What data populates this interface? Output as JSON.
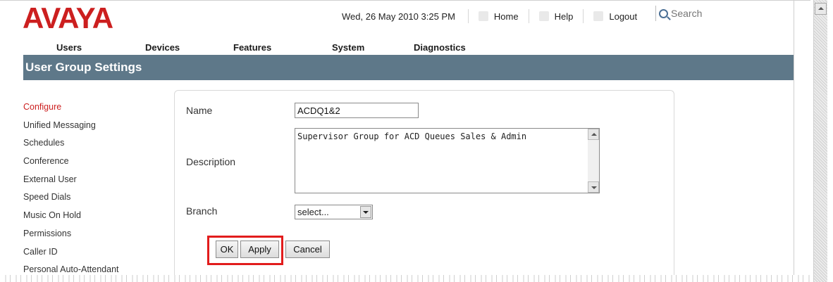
{
  "brand": {
    "logo_text": "AVAYA"
  },
  "topbar": {
    "datetime": "Wed, 26 May 2010 3:25 PM",
    "home_label": "Home",
    "help_label": "Help",
    "logout_label": "Logout",
    "search_placeholder": "Search"
  },
  "nav": {
    "items": [
      {
        "label": "Users"
      },
      {
        "label": "Devices"
      },
      {
        "label": "Features"
      },
      {
        "label": "System"
      },
      {
        "label": "Diagnostics"
      }
    ]
  },
  "page_title": "User Group Settings",
  "sidebar": {
    "items": [
      {
        "label": "Configure"
      },
      {
        "label": "Unified Messaging"
      },
      {
        "label": "Schedules"
      },
      {
        "label": "Conference"
      },
      {
        "label": "External User"
      },
      {
        "label": "Speed Dials"
      },
      {
        "label": "Music On Hold"
      },
      {
        "label": "Permissions"
      },
      {
        "label": "Caller ID"
      },
      {
        "label": "Personal Auto-Attendant"
      }
    ]
  },
  "form": {
    "name_label": "Name",
    "name_value": "ACDQ1&2",
    "description_label": "Description",
    "description_value": "Supervisor Group for ACD Queues Sales & Admin",
    "branch_label": "Branch",
    "branch_selected": "select..."
  },
  "buttons": {
    "ok": "OK",
    "apply": "Apply",
    "cancel": "Cancel"
  },
  "colors": {
    "brand_red": "#cc1f1f",
    "title_bar": "#5e7889",
    "highlight_box": "#e21c1c"
  }
}
